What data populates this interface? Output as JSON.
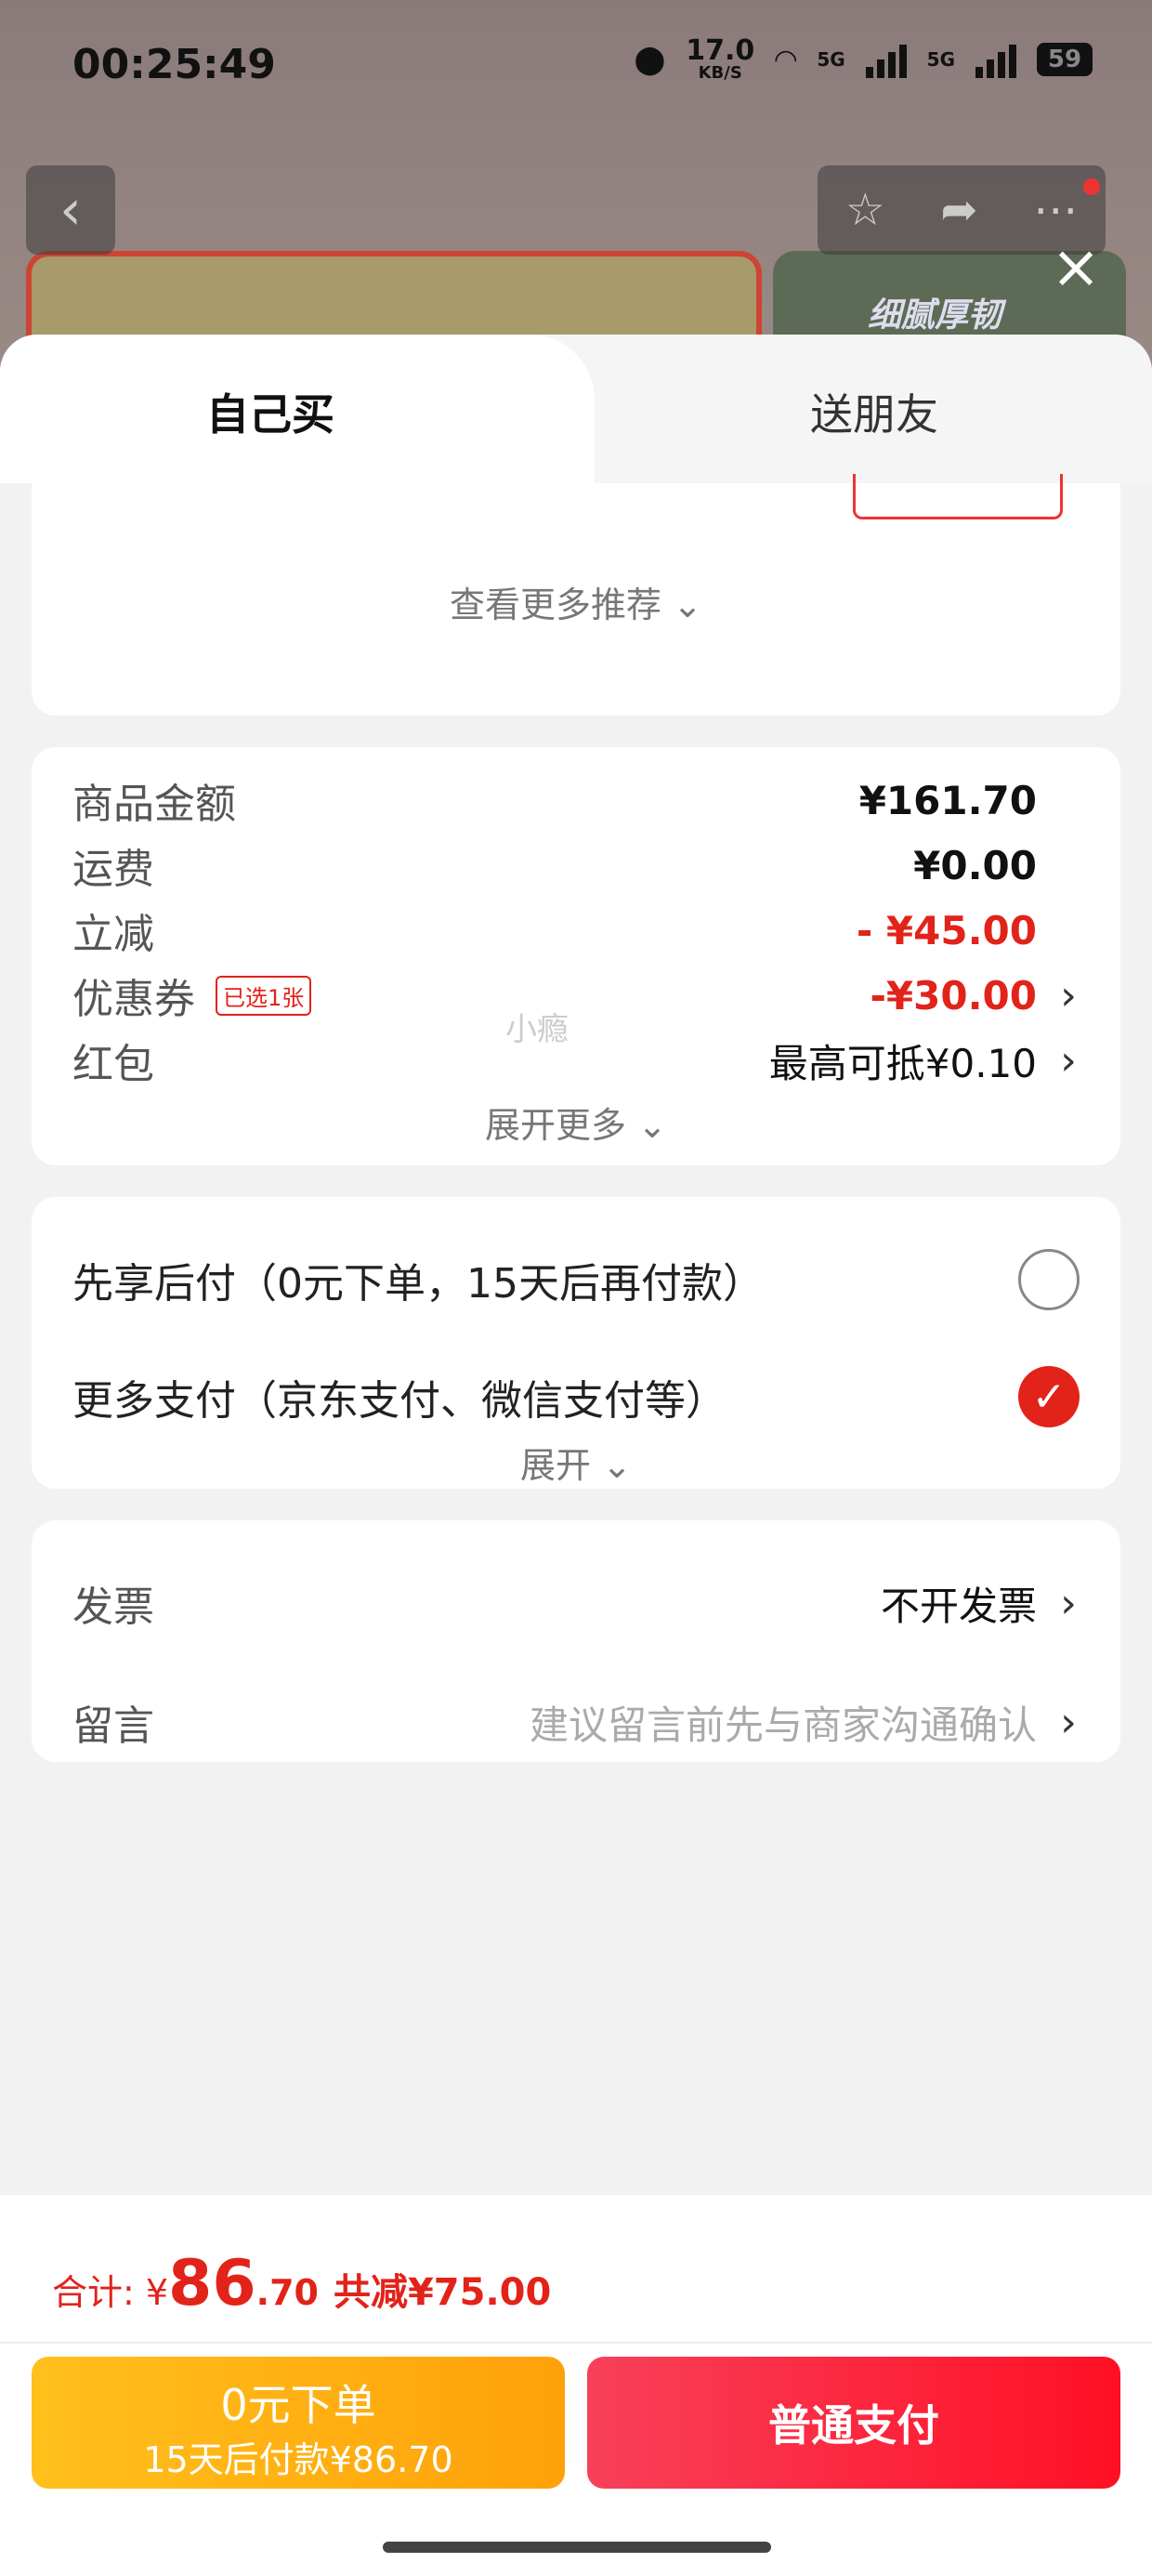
{
  "status_bar": {
    "time": "00:25:49",
    "speed_value": "17.0",
    "speed_unit": "KB/S",
    "net1": "5G",
    "net2": "5G",
    "battery": "59"
  },
  "background": {
    "product_right_text": "细腻厚韧"
  },
  "tabs": [
    {
      "label": "自己买",
      "active": true
    },
    {
      "label": "送朋友",
      "active": false
    }
  ],
  "recommend": {
    "more_label": "查看更多推荐"
  },
  "amounts": {
    "goods": {
      "label": "商品金额",
      "value": "¥161.70"
    },
    "shipping": {
      "label": "运费",
      "value": "¥0.00"
    },
    "discount": {
      "label": "立减",
      "value": "- ¥45.00"
    },
    "coupon": {
      "label": "优惠券",
      "badge": "已选1张",
      "value": "-¥30.00"
    },
    "redpacket": {
      "label": "红包",
      "value": "最高可抵¥0.10"
    },
    "expand_label": "展开更多",
    "watermark": "小瘾"
  },
  "payment": {
    "options": [
      {
        "label": "先享后付（0元下单，15天后再付款）",
        "checked": false
      },
      {
        "label": "更多支付（京东支付、微信支付等）",
        "checked": true
      }
    ],
    "expand_label": "展开"
  },
  "extras": {
    "invoice": {
      "label": "发票",
      "value": "不开发票"
    },
    "message": {
      "label": "留言",
      "placeholder": "建议留言前先与商家沟通确认"
    }
  },
  "bottom_bar": {
    "total_label": "合计:",
    "currency": "¥",
    "total_int": "86",
    "total_dec": ".70",
    "saved": "共减¥75.00",
    "later_btn_line1": "0元下单",
    "later_btn_line2": "15天后付款¥86.70",
    "pay_btn": "普通支付"
  },
  "colors": {
    "accent_red": "#e2231a",
    "later_btn": "#ffa10a",
    "pay_btn": "#ff1024"
  }
}
